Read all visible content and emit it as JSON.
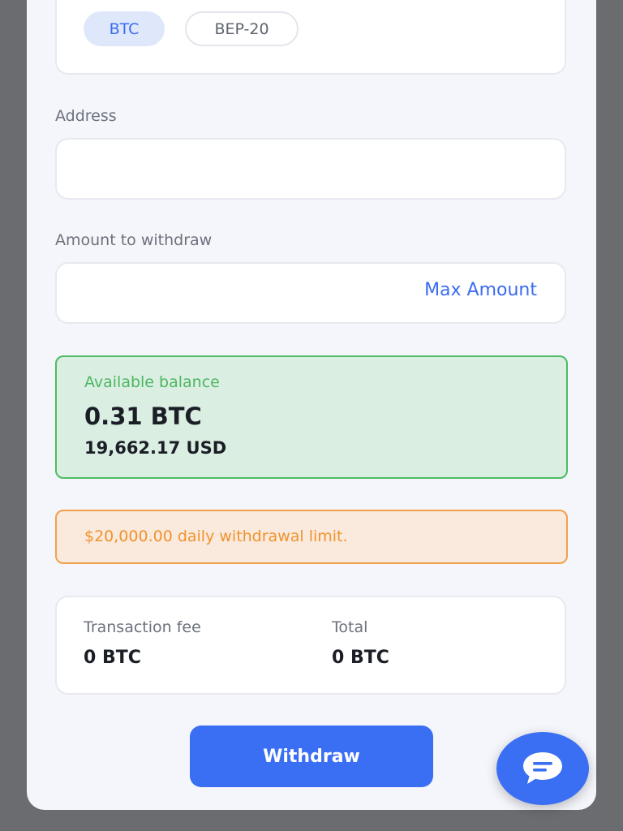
{
  "network": {
    "options": [
      {
        "label": "BTC",
        "selected": true
      },
      {
        "label": "BEP-20",
        "selected": false
      }
    ]
  },
  "address": {
    "label": "Address",
    "value": "",
    "placeholder": ""
  },
  "amount": {
    "label": "Amount to withdraw",
    "value": "",
    "placeholder": "",
    "max_label": "Max Amount"
  },
  "balance": {
    "label": "Available balance",
    "btc": "0.31 BTC",
    "usd": "19,662.17 USD"
  },
  "limit": {
    "text": "$20,000.00 daily withdrawal limit."
  },
  "summary": {
    "fee_label": "Transaction fee",
    "fee_value": "0 BTC",
    "total_label": "Total",
    "total_value": "0 BTC"
  },
  "actions": {
    "withdraw_label": "Withdraw"
  },
  "colors": {
    "accent": "#3a6ff4",
    "success": "#4cbc62",
    "warning": "#f2a04a"
  },
  "icons": {
    "chat": "chat-bubble-icon"
  }
}
